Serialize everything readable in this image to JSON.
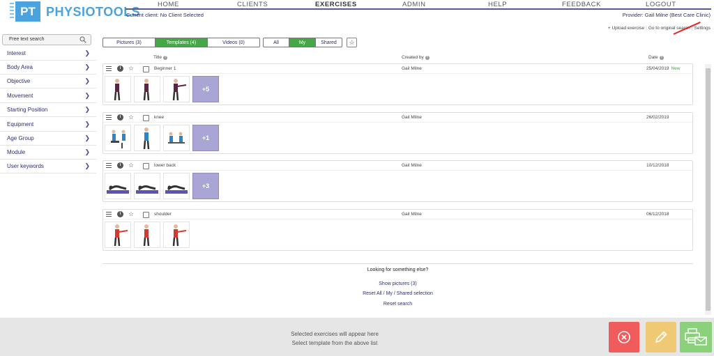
{
  "header": {
    "logo_mark": "PT",
    "logo_text": "PHYSIOTOOLS",
    "nav": [
      "HOME",
      "CLIENTS",
      "EXERCISES",
      "ADMIN",
      "HELP",
      "FEEDBACK",
      "LOGOUT"
    ],
    "active_nav": "EXERCISES",
    "current_client": "Current client: No Client Selected",
    "provider": "Provider: Gail Milne (Best Care Clinic)",
    "links": [
      "+ Upload exercise",
      "Go to original search",
      "Settings"
    ]
  },
  "sidebar": {
    "search_placeholder": "Free text search",
    "items": [
      "Interest",
      "Body Area",
      "Objective",
      "Movement",
      "Starting Position",
      "Equipment",
      "Age Group",
      "Module",
      "User keywords"
    ]
  },
  "tabs": {
    "type": [
      "Pictures (3)",
      "Templates (4)",
      "Videos (0)"
    ],
    "type_active": "Templates (4)",
    "owner": [
      "All",
      "My",
      "Shared"
    ],
    "owner_active": "My"
  },
  "columns": {
    "title": "Title",
    "created_by": "Created by",
    "date": "Date"
  },
  "templates": [
    {
      "title": "Beginner 1",
      "author": "Gail Milne",
      "date": "25/04/2019",
      "badge": "New",
      "more": "+5",
      "thumbs": 3
    },
    {
      "title": "knee",
      "author": "Gail Milne",
      "date": "26/02/2019",
      "badge": "",
      "more": "+1",
      "thumbs": 3
    },
    {
      "title": "lower back",
      "author": "Gail Milne",
      "date": "10/12/2018",
      "badge": "",
      "more": "+3",
      "thumbs": 3
    },
    {
      "title": "shoulder",
      "author": "Gail Milne",
      "date": "06/12/2018",
      "badge": "",
      "more": "",
      "thumbs": 3
    }
  ],
  "bottom": {
    "looking": "Looking for something else?",
    "show_pictures": "Show pictures (3)",
    "reset_selection": "Reset All / My / Shared selection",
    "reset_search": "Reset search"
  },
  "footer": {
    "line1": "Selected exercises will appear here",
    "line2": "Select template from the above list"
  },
  "colors": {
    "brand_blue": "#4aa3df",
    "nav_dark": "#2e2f6b",
    "active_green": "#45a846",
    "more_purple": "#a9a6d6",
    "clear_red": "#f05b5b",
    "edit_yellow": "#f0c975",
    "send_green": "#8bd07b"
  },
  "icons": [
    "search-icon",
    "chevron-right-icon",
    "star-icon",
    "menu-icon",
    "info-icon",
    "close-icon",
    "pencil-icon",
    "print-email-icon"
  ]
}
